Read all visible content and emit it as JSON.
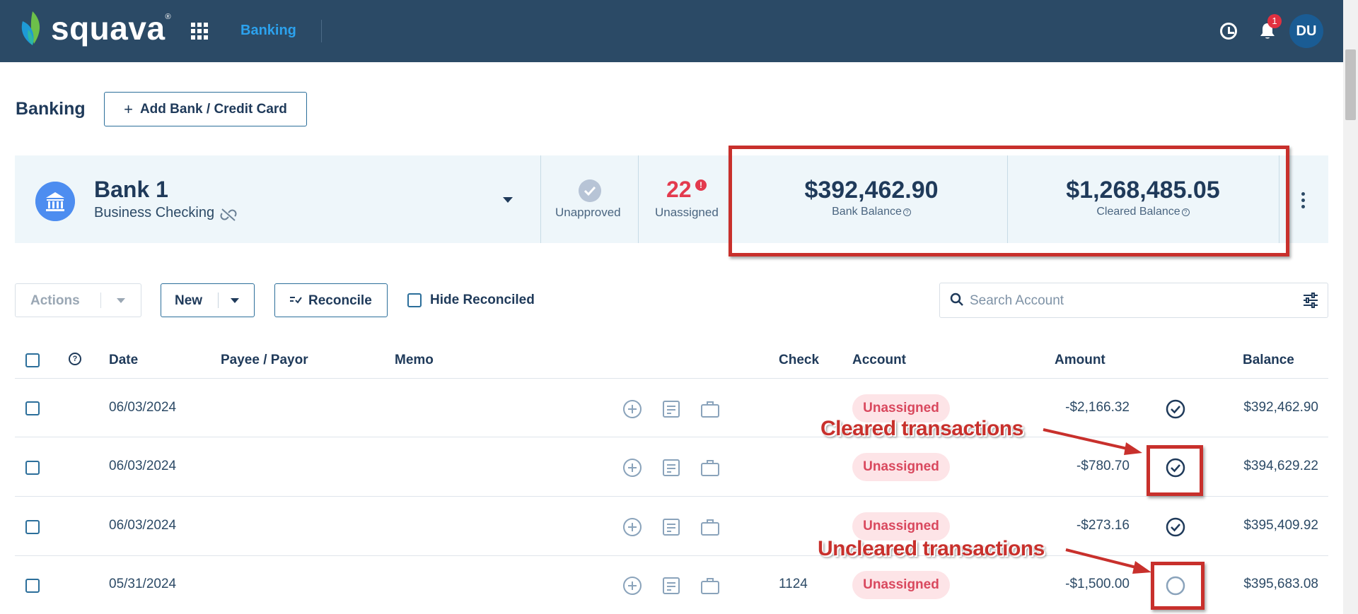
{
  "header": {
    "brand": "squava",
    "brand_mark": "®",
    "nav_link": "Banking",
    "notification_count": "1",
    "avatar_initials": "DU"
  },
  "page": {
    "title": "Banking",
    "add_bank_label": "Add Bank / Credit Card"
  },
  "bank": {
    "name": "Bank 1",
    "account_type": "Business Checking",
    "unapproved_label": "Unapproved",
    "unassigned_count": "22",
    "unassigned_alert": "!",
    "unassigned_label": "Unassigned",
    "bank_balance": "$392,462.90",
    "bank_balance_label": "Bank Balance",
    "cleared_balance": "$1,268,485.05",
    "cleared_balance_label": "Cleared Balance"
  },
  "toolbar": {
    "actions_label": "Actions",
    "new_label": "New",
    "reconcile_label": "Reconcile",
    "hide_reconciled_label": "Hide Reconciled",
    "search_placeholder": "Search Account"
  },
  "table": {
    "columns": {
      "help": "?",
      "date": "Date",
      "payee": "Payee / Payor",
      "memo": "Memo",
      "check": "Check",
      "account": "Account",
      "amount": "Amount",
      "balance": "Balance"
    },
    "rows": [
      {
        "date": "06/03/2024",
        "check": "",
        "account": "Unassigned",
        "amount": "-$2,166.32",
        "cleared": true,
        "balance": "$392,462.90"
      },
      {
        "date": "06/03/2024",
        "check": "",
        "account": "Unassigned",
        "amount": "-$780.70",
        "cleared": true,
        "balance": "$394,629.22"
      },
      {
        "date": "06/03/2024",
        "check": "",
        "account": "Unassigned",
        "amount": "-$273.16",
        "cleared": true,
        "balance": "$395,409.92"
      },
      {
        "date": "05/31/2024",
        "check": "1124",
        "account": "Unassigned",
        "amount": "-$1,500.00",
        "cleared": false,
        "balance": "$395,683.08"
      }
    ]
  },
  "annotations": {
    "cleared": "Cleared transactions",
    "uncleared": "Uncleared transactions"
  },
  "colors": {
    "header_bg": "#2b4a66",
    "accent": "#2ca2ee",
    "alert": "#e33a4e",
    "annotation": "#c8302c"
  }
}
